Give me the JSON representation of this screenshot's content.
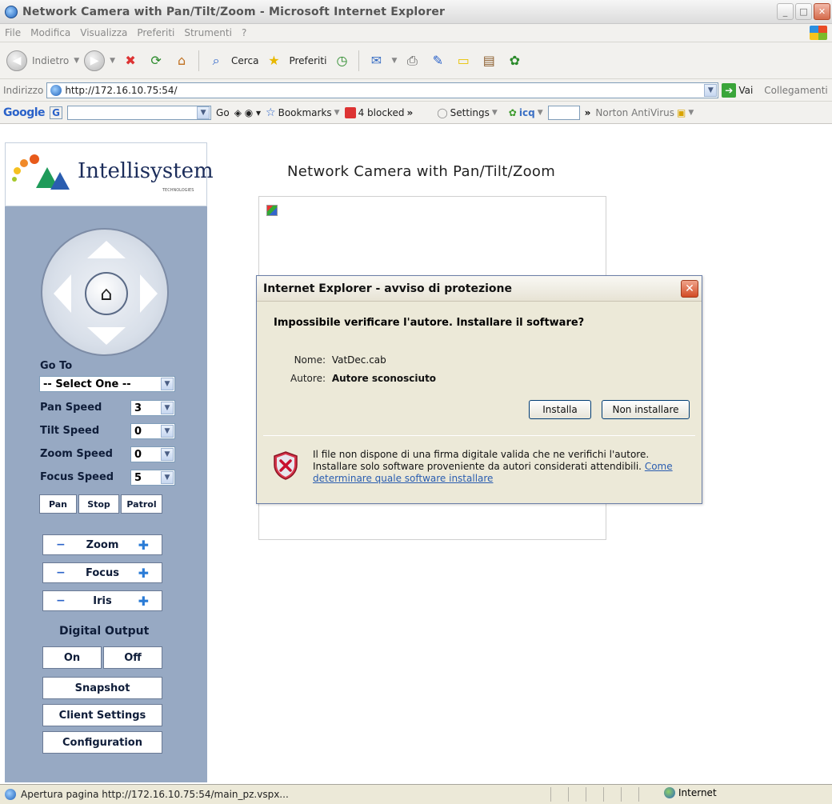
{
  "window": {
    "title": "Network Camera with Pan/Tilt/Zoom - Microsoft Internet Explorer"
  },
  "menu": [
    "File",
    "Modifica",
    "Visualizza",
    "Preferiti",
    "Strumenti",
    "?"
  ],
  "toolbar": {
    "back_label": "Indietro",
    "search_label": "Cerca",
    "favorites_label": "Preferiti"
  },
  "address": {
    "label": "Indirizzo",
    "url": "http://172.16.10.75:54/",
    "go_label": "Vai",
    "links_label": "Collegamenti"
  },
  "google_bar": {
    "logo": "Google",
    "go_label": "Go",
    "bookmarks_label": "Bookmarks",
    "blocked_label": "4 blocked",
    "settings_label": "Settings",
    "icq_label": "icq",
    "norton_label": "Norton AntiVirus"
  },
  "sidebar": {
    "logo_text": "Intellisystem",
    "logo_subtext": "TECHNOLOGIES",
    "goto_label": "Go To",
    "goto_select": "-- Select One --",
    "pan_speed_label": "Pan Speed",
    "pan_speed_value": "3",
    "tilt_speed_label": "Tilt Speed",
    "tilt_speed_value": "0",
    "zoom_speed_label": "Zoom Speed",
    "zoom_speed_value": "0",
    "focus_speed_label": "Focus Speed",
    "focus_speed_value": "5",
    "pan_btn": "Pan",
    "stop_btn": "Stop",
    "patrol_btn": "Patrol",
    "zoom_btn": "Zoom",
    "focus_btn": "Focus",
    "iris_btn": "Iris",
    "digital_output_label": "Digital Output",
    "on_btn": "On",
    "off_btn": "Off",
    "snapshot_btn": "Snapshot",
    "client_settings_btn": "Client Settings",
    "configuration_btn": "Configuration"
  },
  "main": {
    "title": "Network Camera with Pan/Tilt/Zoom"
  },
  "dialog": {
    "title": "Internet Explorer - avviso di protezione",
    "question": "Impossibile verificare l'autore. Installare il software?",
    "name_key": "Nome:",
    "name_value": "VatDec.cab",
    "author_key": "Autore:",
    "author_value": "Autore sconosciuto",
    "install_btn": "Installa",
    "dont_install_btn": "Non installare",
    "warning_text": "Il file non dispone di una firma digitale valida che ne verifichi l'autore. Installare solo software proveniente da autori considerati attendibili.",
    "warning_link": "Come determinare quale software installare"
  },
  "status": {
    "text": "Apertura pagina http://172.16.10.75:54/main_pz.vspx...",
    "zone": "Internet"
  }
}
